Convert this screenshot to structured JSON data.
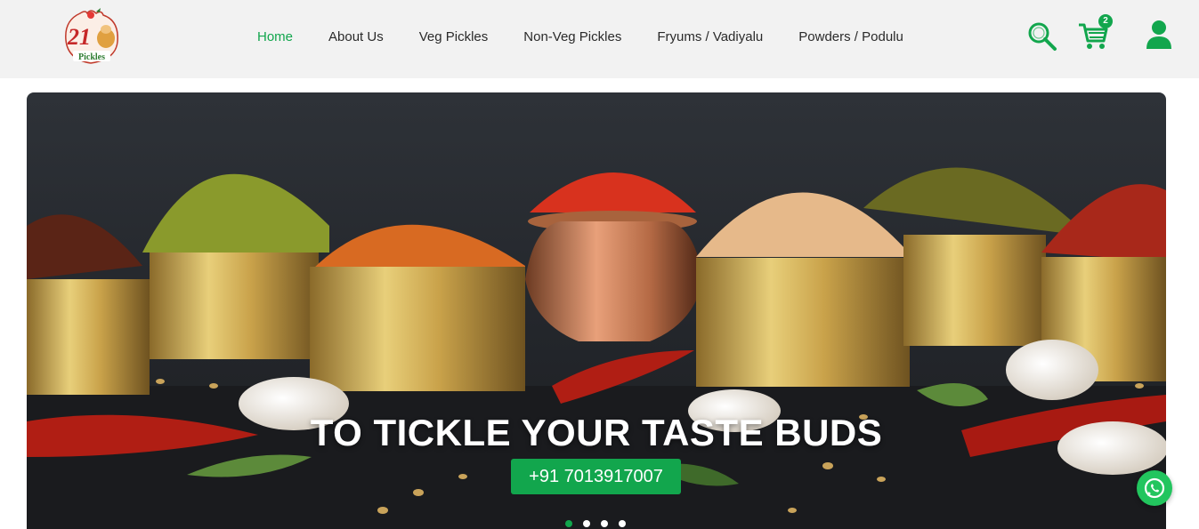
{
  "brand": {
    "logo_number": "21",
    "logo_word": "Pickles",
    "accent_color": "#12a64d"
  },
  "nav": {
    "items": [
      {
        "label": "Home",
        "active": true
      },
      {
        "label": "About Us",
        "active": false
      },
      {
        "label": "Veg Pickles",
        "active": false
      },
      {
        "label": "Non-Veg Pickles",
        "active": false
      },
      {
        "label": "Fryums / Vadiyalu",
        "active": false
      },
      {
        "label": "Powders / Podulu",
        "active": false
      }
    ]
  },
  "header_actions": {
    "search_icon": "search-icon",
    "cart_icon": "cart-icon",
    "cart_count": "2",
    "user_icon": "user-icon"
  },
  "hero": {
    "title": "TO TICKLE YOUR TASTE BUDS",
    "phone_label": "+91 7013917007",
    "slides": 4,
    "active_slide": 1
  },
  "floating": {
    "whatsapp_icon": "whatsapp-icon"
  }
}
